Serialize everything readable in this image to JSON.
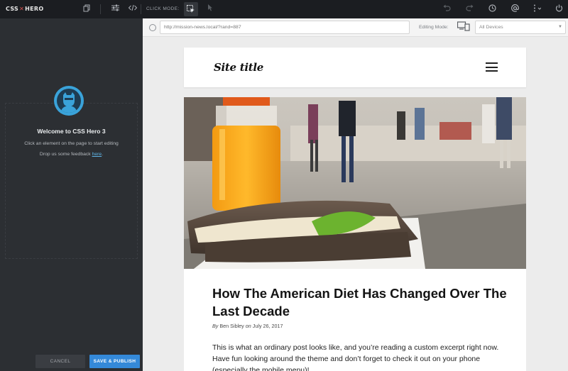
{
  "toolbar": {
    "logo_left": "CSS",
    "logo_sep": "✕",
    "logo_right": "HERO",
    "click_mode_label": "CLICK MODE:",
    "icons": [
      "copy-icon",
      "sliders-icon",
      "code-icon",
      "select-element-icon",
      "pointer-icon",
      "undo-icon",
      "redo-icon",
      "history-icon",
      "at-icon",
      "more-icon",
      "power-icon"
    ]
  },
  "sidebar": {
    "welcome_title": "Welcome to CSS Hero 3",
    "welcome_text": "Click an element on the page to start editing",
    "feedback_prefix": "Drop us some feedback ",
    "feedback_link": "here",
    "feedback_suffix": ".",
    "cancel_label": "CANCEL",
    "save_label": "SAVE & PUBLISH"
  },
  "urlbar": {
    "url": "http://mission-news.local/?rand=887",
    "editing_mode_label": "Editing Mode:",
    "device_selected": "All Devices"
  },
  "site": {
    "title": "Site title",
    "post_title": "How The American Diet Has Changed Over The Last Decade",
    "byline_by": "By",
    "byline_author": "Ben Sibley",
    "byline_on": "on",
    "byline_date": "July 26, 2017",
    "excerpt": "This is what an ordinary post looks like, and you’re reading a custom excerpt right now. Have fun looking around the theme and don’t forget to check it out on your phone (especially the mobile menu)!"
  },
  "colors": {
    "toolbar_bg": "#1b1d21",
    "sidebar_bg": "#2c2f33",
    "accent_blue": "#3489d9",
    "link_blue": "#5fb4e6"
  }
}
